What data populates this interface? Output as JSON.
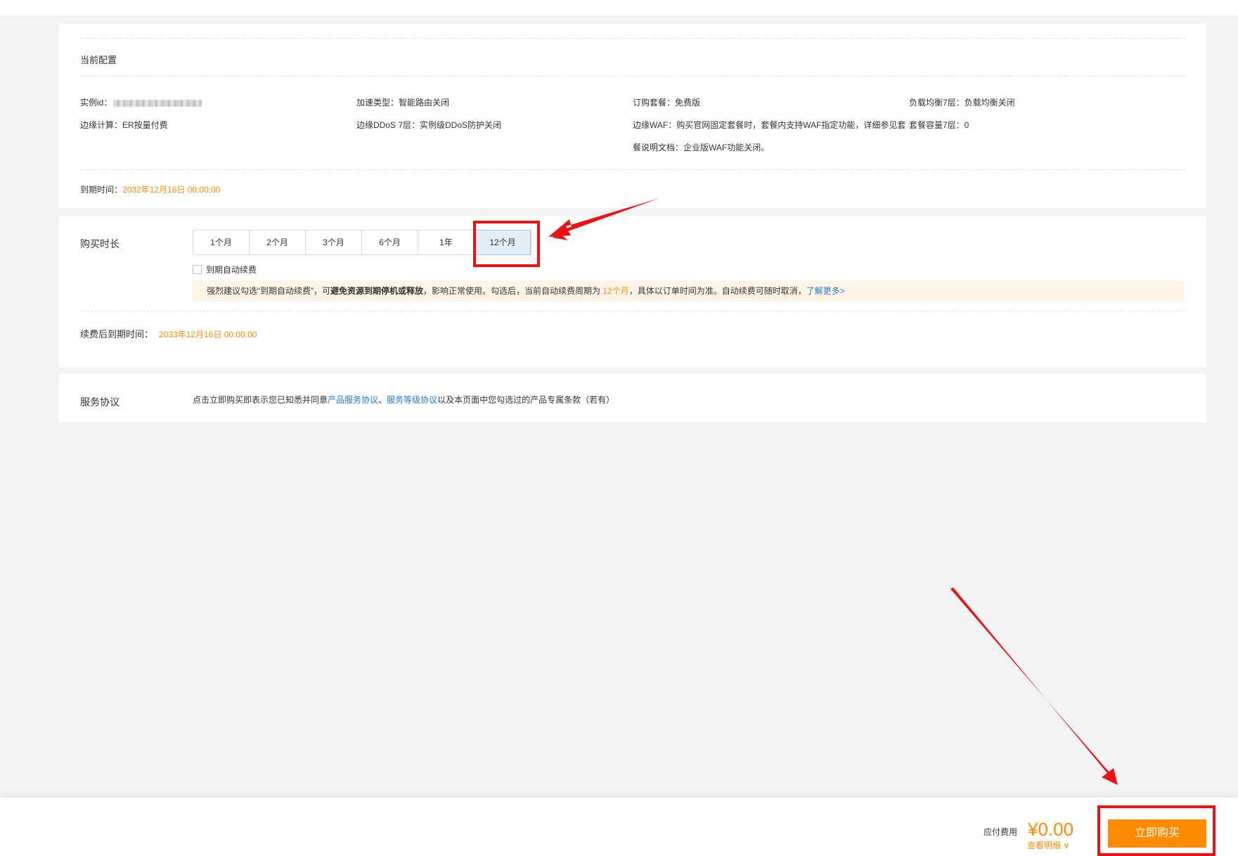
{
  "current_config": {
    "title": "当前配置",
    "instance_id_label": "实例id：",
    "acceleration": "加速类型：智能路由关闭",
    "package": "订购套餐：免费版",
    "lb7": "负载均衡7层：负载均衡关闭",
    "edge_compute": "边缘计算：ER按量付费",
    "ddos7": "边缘DDoS 7层：实例级DDoS防护关闭",
    "waf_line1": "边缘WAF：购买官网固定套餐时，套餐内支持WAF指定功能，详细参见套",
    "waf_line2": "餐说明文档：企业版WAF功能关闭。",
    "capacity7": "套餐容量7层：0",
    "expiry_label": "到期时间：",
    "expiry_value": "2032年12月16日 00:00:00"
  },
  "duration": {
    "label": "购买时长",
    "options": [
      "1个月",
      "2个月",
      "3个月",
      "6个月",
      "1年",
      "12个月"
    ],
    "selected": "12个月",
    "auto_renew_label": "到期自动续费",
    "notice": {
      "part1": "强烈建议勾选“到期自动续费”，可",
      "bold": "避免资源到期停机或释放",
      "part2": "，影响正常使用。勾选后，当前自动续费周期为 ",
      "period": "12个月",
      "part3": "，具体以订单时间为准。自动续费可随时取消，",
      "link": "了解更多>"
    },
    "renew_expiry_label": "续费后到期时间：",
    "renew_expiry_value": "2033年12月16日 00:00:00"
  },
  "agreement": {
    "label": "服务协议",
    "text1": "点击立即购买即表示您已知悉并同意",
    "link1": "产品服务协议",
    "sep": "、",
    "link2": "服务等级协议",
    "text2": "以及本页面中您勾选过的产品专属条款（若有）"
  },
  "footer": {
    "fee_label": "应付费用",
    "fee_amount": "¥0.00",
    "detail_link": "查看明细 ∨",
    "buy_button": "立即购买"
  },
  "colors": {
    "accent_orange": "#ff8a00",
    "link_blue": "#1f7ad1",
    "annotation_red": "#ee1111",
    "selected_bg": "#e2eef8"
  }
}
